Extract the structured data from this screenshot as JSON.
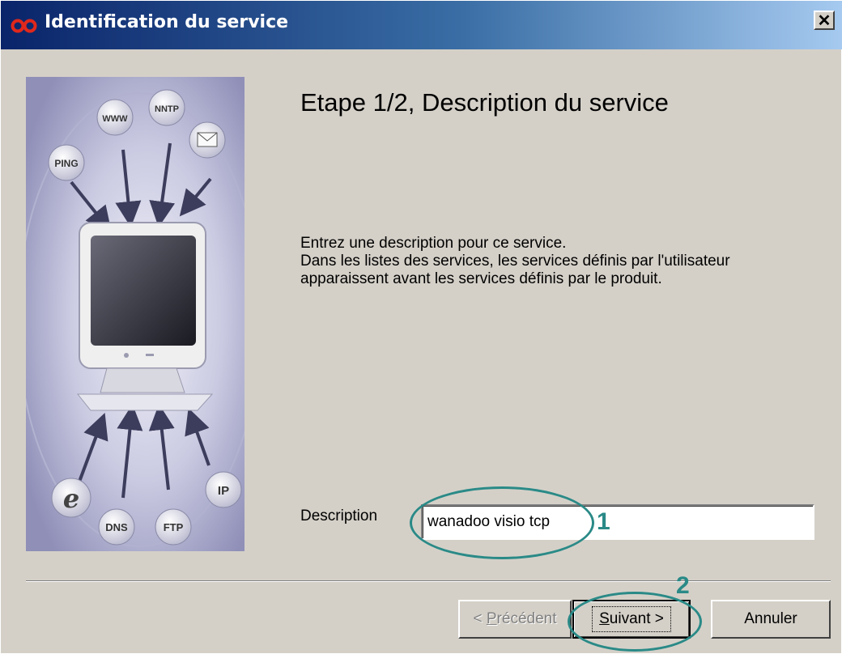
{
  "window": {
    "title": "Identification du service",
    "close_label": "✕"
  },
  "side_image": {
    "labels": [
      "WWW",
      "NNTP",
      "PING",
      "DNS",
      "FTP",
      "IP"
    ],
    "icons": [
      "mail-icon",
      "internet-explorer-icon",
      "monitor-icon"
    ]
  },
  "step": {
    "heading": "Etape 1/2, Description du service",
    "desc_line1": "Entrez une description pour ce service.",
    "desc_line2": "Dans les listes des services, les services définis par l'utilisateur",
    "desc_line3": "apparaissent avant les services définis par le produit."
  },
  "form": {
    "description_label": "Description",
    "description_value": "wanadoo visio tcp"
  },
  "annotations": {
    "marker1": "1",
    "marker2": "2",
    "color": "#2a8a87"
  },
  "buttons": {
    "previous": {
      "prefix": "< ",
      "accel": "P",
      "rest": "récédent"
    },
    "next": {
      "accel": "S",
      "rest": "uivant >"
    },
    "cancel": "Annuler"
  }
}
